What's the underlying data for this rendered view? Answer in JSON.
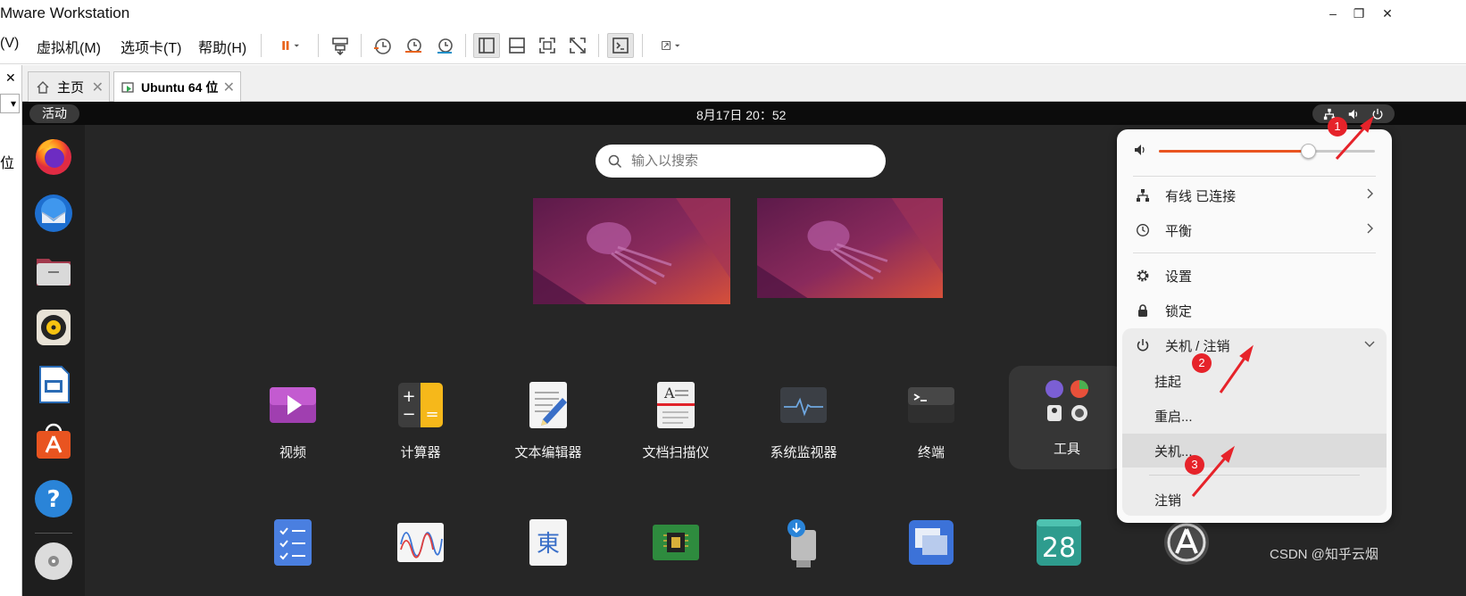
{
  "window": {
    "title": "Mware Workstation",
    "minimize": "–",
    "restore": "❐",
    "close": "✕"
  },
  "menubar": {
    "view": "(V)",
    "vm": "虚拟机(M)",
    "tabs": "选项卡(T)",
    "help": "帮助(H)"
  },
  "left_strip": {
    "close": "✕",
    "dropdown": "▾",
    "partial_text": "位"
  },
  "tabs": [
    {
      "label": "主页",
      "icon": "home-icon",
      "close": "✕"
    },
    {
      "label": "Ubuntu 64 位",
      "icon": "vm-running-icon",
      "close": "✕"
    }
  ],
  "ubuntu": {
    "activities": "活动",
    "clock": "8月17日  20：52",
    "search_placeholder": "输入以搜索",
    "dock": [
      "firefox-icon",
      "thunderbird-icon",
      "files-icon",
      "rhythmbox-icon",
      "libreoffice-impress-icon",
      "app-center-icon",
      "help-icon",
      "disc-icon"
    ],
    "apps_row1": [
      {
        "label": "视频",
        "icon": "videos-icon"
      },
      {
        "label": "计算器",
        "icon": "calculator-icon"
      },
      {
        "label": "文本编辑器",
        "icon": "text-editor-icon"
      },
      {
        "label": "文档扫描仪",
        "icon": "scanner-icon"
      },
      {
        "label": "系统监视器",
        "icon": "system-monitor-icon"
      },
      {
        "label": "终端",
        "icon": "terminal-icon"
      },
      {
        "label": "工具",
        "icon": "utilities-folder-icon"
      }
    ],
    "apps_row2": [
      "todo-icon",
      "power-statistics-icon",
      "language-icon",
      "chip-icon",
      "usb-installer-icon",
      "remmina-icon",
      "calendar-icon",
      "app-store-icon"
    ],
    "calendar_day": "28"
  },
  "quick_settings": {
    "volume_level": 0.69,
    "network": "有线 已连接",
    "power_mode": "平衡",
    "settings": "设置",
    "lock": "锁定",
    "power_menu": "关机 / 注销",
    "suspend": "挂起",
    "restart": "重启...",
    "poweroff": "关机...",
    "logout": "注销"
  },
  "annotations": {
    "step1": "1",
    "step2": "2",
    "step3": "3",
    "color": "#e6232a"
  },
  "watermark": "CSDN @知乎云烟",
  "colors": {
    "ubuntu_orange": "#e95420",
    "guest_bg": "#262626"
  }
}
